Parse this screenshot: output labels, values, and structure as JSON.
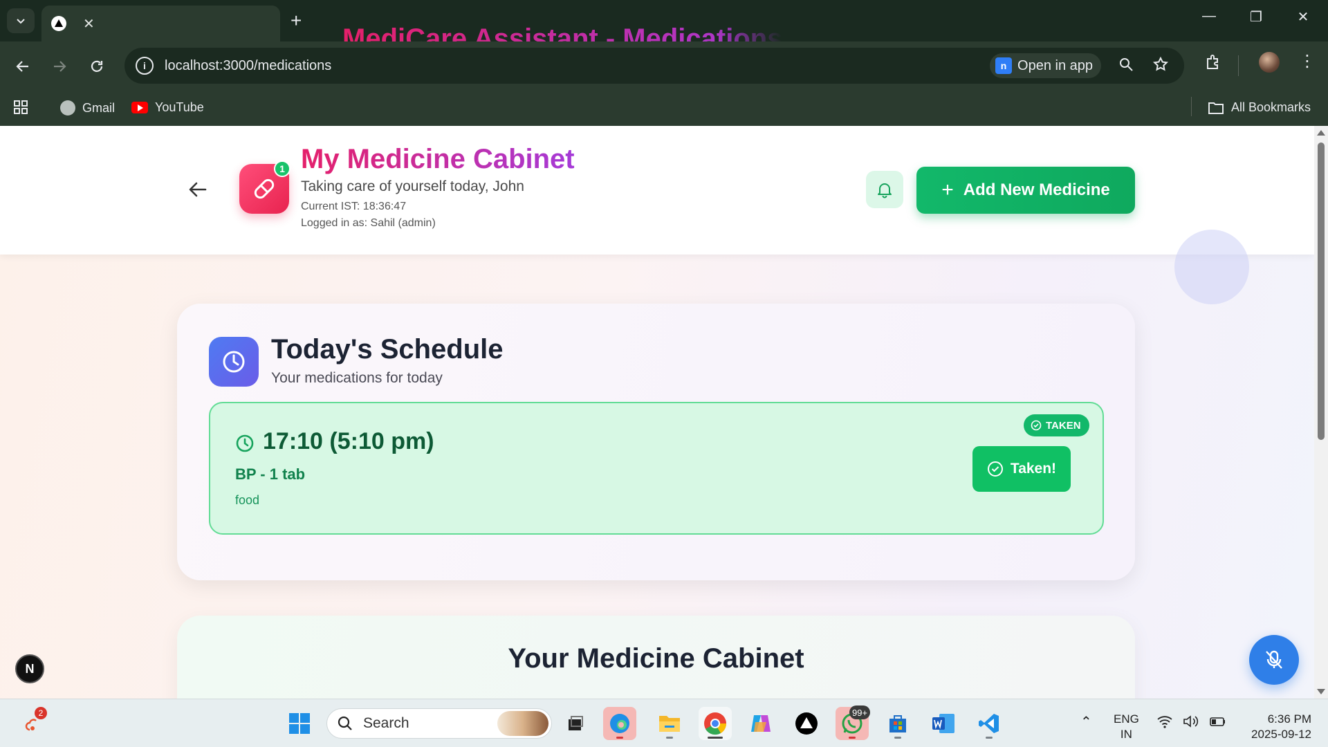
{
  "browser": {
    "tab_title": "MediCare Assistant - Medications",
    "url": "localhost:3000/medications",
    "open_in_app": "Open in app",
    "open_in_app_icon_letter": "n",
    "bookmarks": [
      "Gmail",
      "YouTube"
    ],
    "all_bookmarks": "All Bookmarks"
  },
  "header": {
    "title": "My Medicine Cabinet",
    "subtitle": "Taking care of yourself today, John",
    "time": "Current IST: 18:36:47",
    "logged_in": "Logged in as: Sahil (admin)",
    "badge_count": "1",
    "add_button": "Add New Medicine"
  },
  "schedule": {
    "title": "Today's Schedule",
    "subtitle": "Your medications for today",
    "doses": [
      {
        "time": "17:10 (5:10 pm)",
        "name": "BP - 1 tab",
        "note": "food",
        "status": "TAKEN",
        "button": "Taken!"
      }
    ]
  },
  "cabinet": {
    "title": "Your Medicine Cabinet"
  },
  "floating": {
    "next_badge": "N"
  },
  "taskbar": {
    "search_placeholder": "Search",
    "whatsapp_badge": "99+",
    "notification_badge": "2",
    "lang_line1": "ENG",
    "lang_line2": "IN",
    "clock_time": "6:36 PM",
    "clock_date": "2025-09-12"
  },
  "colors": {
    "brand_green": "#12b86a",
    "title_gradient_start": "#e5206a",
    "title_gradient_end": "#a53ad8",
    "schedule_icon": "#4f7bf2",
    "mic_button": "#2f7fe8"
  }
}
